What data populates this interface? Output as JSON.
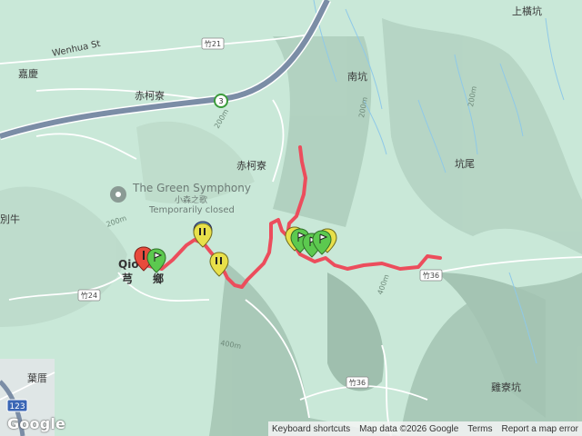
{
  "map": {
    "labels": {
      "wenhua": "Wenhua St",
      "zhu21": "竹21",
      "jiaqing": "嘉慶",
      "chikeliao1": "赤柯寮",
      "chikeliao2": "赤柯寮",
      "route3": "3",
      "nankeng": "南坑",
      "shanghengkeng": "上橫坑",
      "kengwei": "坑尾",
      "zhu24": "竹24",
      "zhu36a": "竹36",
      "zhu36b": "竹36",
      "jiliaokeng": "雞寮坑",
      "yeliao": "葉厝",
      "r123": "123",
      "bieniu": "別牛",
      "contour200a": "200m",
      "contour200b": "200m",
      "contour200c": "200m",
      "contour200d": "200m",
      "contour400a": "400m",
      "contour400b": "400m",
      "qiong_latin": "Qio",
      "qiong_cn": "芎",
      "qiong_suffix": "鄉",
      "poi_name": "The Green Symphony",
      "poi_name_cn": "小森之歌",
      "poi_status": "Temporarily closed"
    },
    "colors": {
      "route": "#ec4d5c",
      "marker_green": "#5cc94f",
      "marker_yellow": "#e8e04a",
      "marker_red": "#e84b3c",
      "highway": "#7b8da6"
    }
  },
  "footer": {
    "logo": "Google",
    "keyboard": "Keyboard shortcuts",
    "mapdata": "Map data ©2026 Google",
    "terms": "Terms",
    "report": "Report a map error"
  }
}
